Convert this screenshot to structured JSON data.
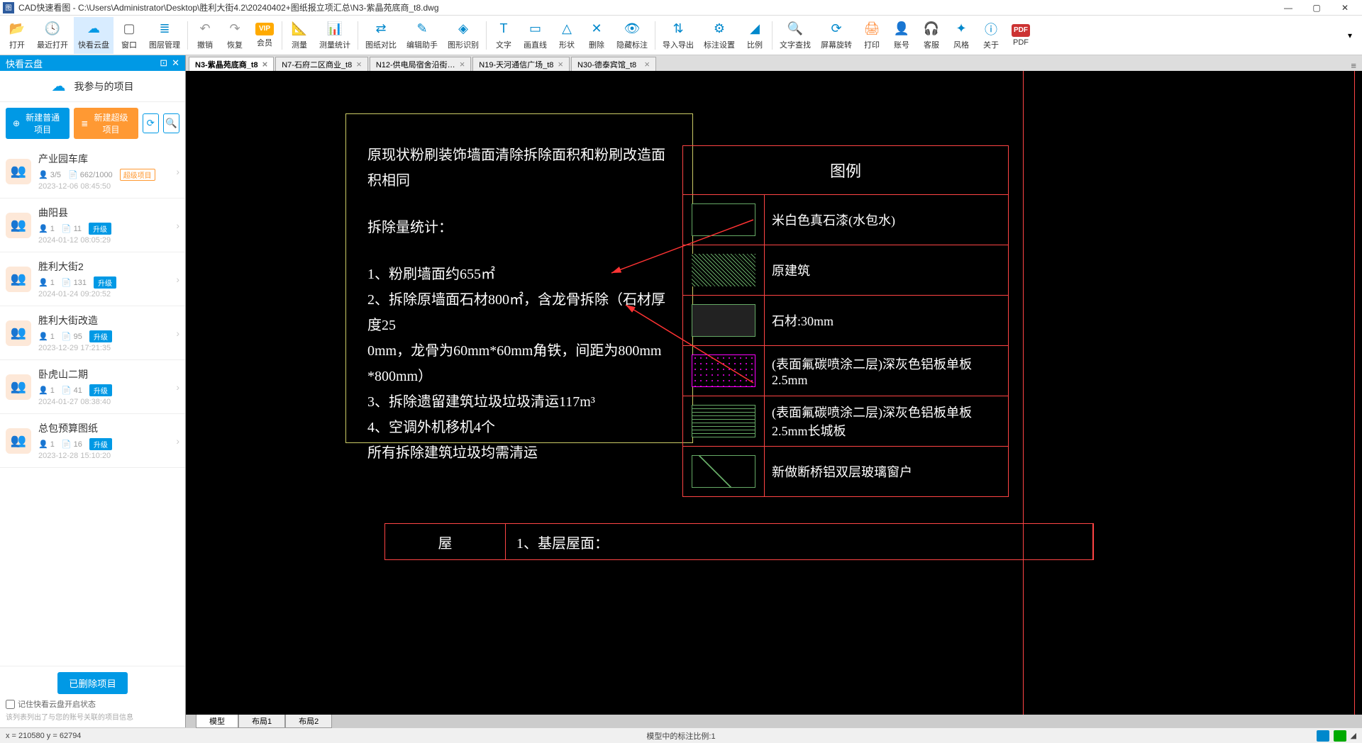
{
  "window": {
    "title": "CAD快速看图 - C:\\Users\\Administrator\\Desktop\\胜利大街4.2\\20240402+图纸报立项汇总\\N3-紫晶苑底商_t8.dwg"
  },
  "toolbar": [
    {
      "icon": "📂",
      "label": "打开",
      "color": "#0088cc"
    },
    {
      "icon": "🕓",
      "label": "最近打开",
      "color": "#0088cc"
    },
    {
      "icon": "☁",
      "label": "快看云盘",
      "color": "#0099e5",
      "active": true
    },
    {
      "icon": "▢",
      "label": "窗口",
      "color": "#666"
    },
    {
      "icon": "≣",
      "label": "图层管理",
      "color": "#0088cc"
    },
    {
      "sep": true
    },
    {
      "icon": "↶",
      "label": "撤销",
      "color": "#999"
    },
    {
      "icon": "↷",
      "label": "恢复",
      "color": "#999"
    },
    {
      "icon": "VIP",
      "label": "会员",
      "color": "#ffaa00"
    },
    {
      "sep": true
    },
    {
      "icon": "📐",
      "label": "测量",
      "color": "#0088cc"
    },
    {
      "icon": "📊",
      "label": "测量统计",
      "color": "#0088cc"
    },
    {
      "sep": true
    },
    {
      "icon": "⇄",
      "label": "图纸对比",
      "color": "#0088cc"
    },
    {
      "icon": "✎",
      "label": "编辑助手",
      "color": "#0088cc"
    },
    {
      "icon": "◈",
      "label": "图形识别",
      "color": "#0088cc"
    },
    {
      "sep": true
    },
    {
      "icon": "T",
      "label": "文字",
      "color": "#0088cc"
    },
    {
      "icon": "▭",
      "label": "画直线",
      "color": "#0088cc"
    },
    {
      "icon": "△",
      "label": "形状",
      "color": "#0088cc"
    },
    {
      "icon": "✕",
      "label": "删除",
      "color": "#0088cc"
    },
    {
      "icon": "👁",
      "label": "隐藏标注",
      "color": "#0088cc"
    },
    {
      "sep": true
    },
    {
      "icon": "⇅",
      "label": "导入导出",
      "color": "#0088cc"
    },
    {
      "icon": "⚙",
      "label": "标注设置",
      "color": "#0088cc"
    },
    {
      "icon": "◢",
      "label": "比例",
      "color": "#0088cc"
    },
    {
      "sep": true
    },
    {
      "icon": "🔍",
      "label": "文字查找",
      "color": "#0088cc"
    },
    {
      "icon": "⟳",
      "label": "屏幕旋转",
      "color": "#0088cc"
    },
    {
      "icon": "🖨",
      "label": "打印",
      "color": "#ff8833"
    },
    {
      "icon": "👤",
      "label": "账号",
      "color": "#0088cc"
    },
    {
      "icon": "🎧",
      "label": "客服",
      "color": "#0088cc"
    },
    {
      "icon": "✦",
      "label": "风格",
      "color": "#0088cc"
    },
    {
      "icon": "ⓘ",
      "label": "关于",
      "color": "#0088cc"
    },
    {
      "icon": "PDF",
      "label": "PDF",
      "color": "#cc3333"
    }
  ],
  "left_panel": {
    "header": "快看云盘",
    "sub_title": "我参与的项目",
    "btn_new_normal": "新建普通项目",
    "btn_new_super": "新建超级项目",
    "projects": [
      {
        "name": "产业园车库",
        "users": "3/5",
        "files": "662/1000",
        "date": "2023-12-06 08:45:50",
        "super": true
      },
      {
        "name": "曲阳县",
        "users": "1",
        "files": "11",
        "date": "2024-01-12 08:05:29",
        "upgrade": true
      },
      {
        "name": "胜利大街2",
        "users": "1",
        "files": "131",
        "date": "2024-01-24 09:20:52",
        "upgrade": true
      },
      {
        "name": "胜利大街改造",
        "users": "1",
        "files": "95",
        "date": "2023-12-29 17:21:35",
        "upgrade": true
      },
      {
        "name": "卧虎山二期",
        "users": "1",
        "files": "41",
        "date": "2024-01-27 08:38:40",
        "upgrade": true
      },
      {
        "name": "总包预算图纸",
        "users": "1",
        "files": "16",
        "date": "2023-12-28 15:10:20",
        "upgrade": true
      }
    ],
    "upgrade_label": "升级",
    "super_label": "超级项目",
    "deleted_btn": "已删除项目",
    "remember_check": "记住快看云盘开启状态",
    "hint": "该列表列出了与您的账号关联的项目信息"
  },
  "tabs": [
    {
      "label": "N3-紫晶苑底商_t8",
      "active": true
    },
    {
      "label": "N7-石府二区商业_t8"
    },
    {
      "label": "N12-供电局宿舍沿街…"
    },
    {
      "label": "N19-天河通信广场_t8"
    },
    {
      "label": "N30-德泰宾馆_t8"
    }
  ],
  "cad_text": {
    "l1": "原现状粉刷装饰墙面清除拆除面积和粉刷改造面积相同",
    "l2": "拆除量统计：",
    "l3": "1、粉刷墙面约655㎡",
    "l4": "2、拆除原墙面石材800㎡，含龙骨拆除（石材厚度25",
    "l5": "0mm，龙骨为60mm*60mm角铁，间距为800mm",
    "l6": "*800mm）",
    "l7": "3、拆除遗留建筑垃圾垃圾清运117m³",
    "l8": "4、空调外机移机4个",
    "l9": "所有拆除建筑垃圾均需清运"
  },
  "legend": {
    "title": "图例",
    "rows": [
      {
        "label": "米白色真石漆(水包水)"
      },
      {
        "label": "原建筑"
      },
      {
        "label": "石材:30mm"
      },
      {
        "label": "(表面氟碳喷涂二层)深灰色铝板单板2.5mm"
      },
      {
        "label": "(表面氟碳喷涂二层)深灰色铝板单板2.5mm长城板"
      },
      {
        "label": "新做断桥铝双层玻璃窗户"
      }
    ]
  },
  "bottom_row": {
    "c1": "屋",
    "c2": "1、基层屋面："
  },
  "layout_tabs": [
    "模型",
    "布局1",
    "布局2"
  ],
  "status": {
    "coords": "x = 210580  y = 62794",
    "center": "模型中的标注比例:1"
  }
}
